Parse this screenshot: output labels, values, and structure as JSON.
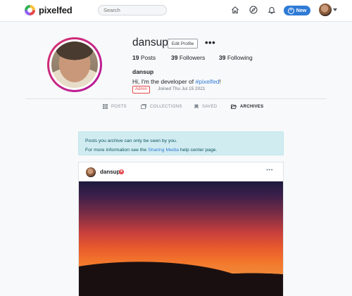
{
  "navbar": {
    "brand": "pixelfed",
    "search_placeholder": "Search",
    "new_button": "New",
    "icons": [
      "home-icon",
      "compass-icon",
      "bell-icon"
    ]
  },
  "profile": {
    "username": "dansup",
    "edit_profile": "Edit Profile",
    "more": "•••",
    "stats": {
      "posts_count": "19",
      "posts_label": "Posts",
      "followers_count": "39",
      "followers_label": "Followers",
      "following_count": "39",
      "following_label": "Following"
    },
    "display_name": "dansup",
    "bio_prefix": "Hi, I'm the developer of ",
    "bio_tag": "#pixelfed",
    "bio_suffix": "!",
    "admin_badge": "Admin",
    "joined": "Joined Thu Jul 15 2021"
  },
  "tabs": [
    {
      "label": "POSTS",
      "active": false
    },
    {
      "label": "COLLECTIONS",
      "active": false
    },
    {
      "label": "SAVED",
      "active": false
    },
    {
      "label": "ARCHIVES",
      "active": true
    }
  ],
  "alert": {
    "line1": "Posts you archive can only be seen by you.",
    "line2_prefix": "For more information see the ",
    "line2_link": "Sharing Media",
    "line2_suffix": " help center page."
  },
  "post": {
    "username": "dansup",
    "more": "•••"
  },
  "colors": {
    "accent": "#2f7bd6",
    "admin": "#e5484d",
    "alert_bg": "#d1ecf1"
  }
}
